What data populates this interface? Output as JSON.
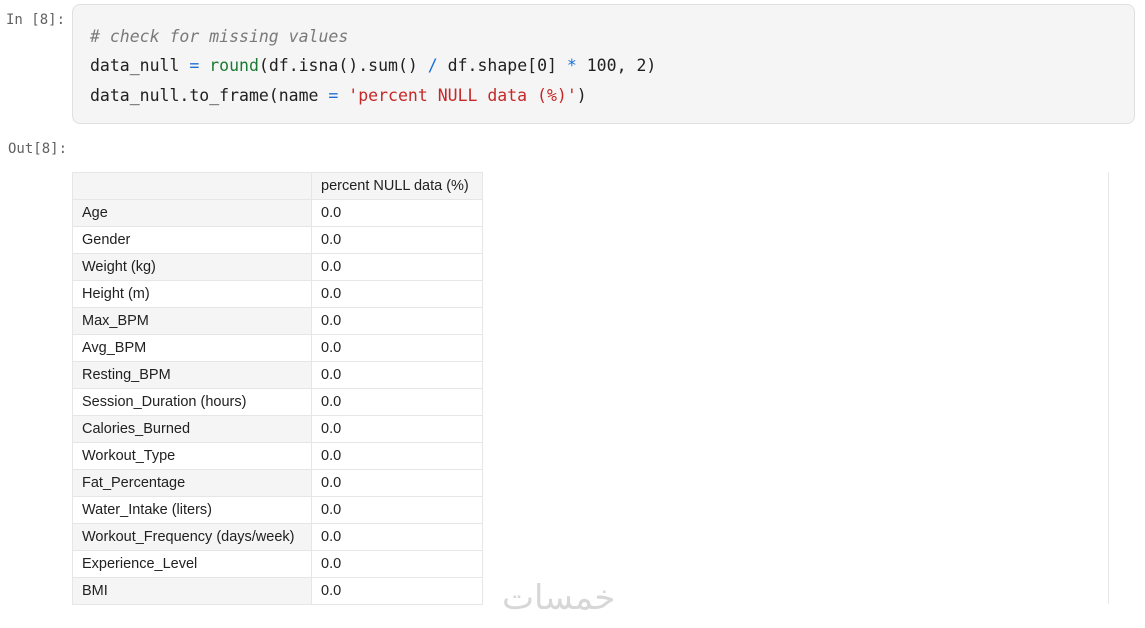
{
  "cell": {
    "in_prompt": "In [8]:",
    "out_prompt": "Out[8]:",
    "code": {
      "line1_comment": "# check for missing values",
      "line2": {
        "var": "data_null",
        "eq": "=",
        "fn": "round",
        "expr1": "(df.isna().sum() ",
        "div": "/",
        "expr2": " df.shape[",
        "idx": "0",
        "expr3": "] ",
        "mul": "*",
        "num100": " 100",
        "comma": ", ",
        "num2": "2",
        "close": ")"
      },
      "line3": {
        "call": "data_null.to_frame(name ",
        "eq": "=",
        "space": " ",
        "str": "'percent NULL data (%)'",
        "close": ")"
      }
    }
  },
  "output": {
    "column_header": "percent NULL data (%)",
    "rows": [
      {
        "index": "Age",
        "value": "0.0"
      },
      {
        "index": "Gender",
        "value": "0.0"
      },
      {
        "index": "Weight (kg)",
        "value": "0.0"
      },
      {
        "index": "Height (m)",
        "value": "0.0"
      },
      {
        "index": "Max_BPM",
        "value": "0.0"
      },
      {
        "index": "Avg_BPM",
        "value": "0.0"
      },
      {
        "index": "Resting_BPM",
        "value": "0.0"
      },
      {
        "index": "Session_Duration (hours)",
        "value": "0.0"
      },
      {
        "index": "Calories_Burned",
        "value": "0.0"
      },
      {
        "index": "Workout_Type",
        "value": "0.0"
      },
      {
        "index": "Fat_Percentage",
        "value": "0.0"
      },
      {
        "index": "Water_Intake (liters)",
        "value": "0.0"
      },
      {
        "index": "Workout_Frequency (days/week)",
        "value": "0.0"
      },
      {
        "index": "Experience_Level",
        "value": "0.0"
      },
      {
        "index": "BMI",
        "value": "0.0"
      }
    ]
  },
  "watermark": "خمسات"
}
